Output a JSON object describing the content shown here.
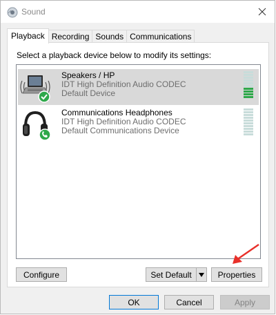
{
  "window": {
    "title": "Sound"
  },
  "tabs": [
    "Playback",
    "Recording",
    "Sounds",
    "Communications"
  ],
  "active_tab": 0,
  "instruction": "Select a playback device below to modify its settings:",
  "devices": [
    {
      "name": "Speakers / HP",
      "driver": "IDT High Definition Audio CODEC",
      "status": "Default Device",
      "icon": "laptop-speakers-icon",
      "badge": "green-check-badge",
      "selected": true,
      "level_fraction": 0.4
    },
    {
      "name": "Communications Headphones",
      "driver": "IDT High Definition Audio CODEC",
      "status": "Default Communications Device",
      "icon": "headphones-icon",
      "badge": "green-phone-badge",
      "selected": false,
      "level_fraction": 0
    }
  ],
  "buttons": {
    "configure": "Configure",
    "set_default": "Set Default",
    "properties": "Properties",
    "ok": "OK",
    "cancel": "Cancel",
    "apply": "Apply"
  },
  "colors": {
    "level_active": "#2ea84a",
    "level_inactive": "#c8dcda",
    "selection": "#d9d9d9",
    "annotation_arrow": "#e8302a"
  }
}
